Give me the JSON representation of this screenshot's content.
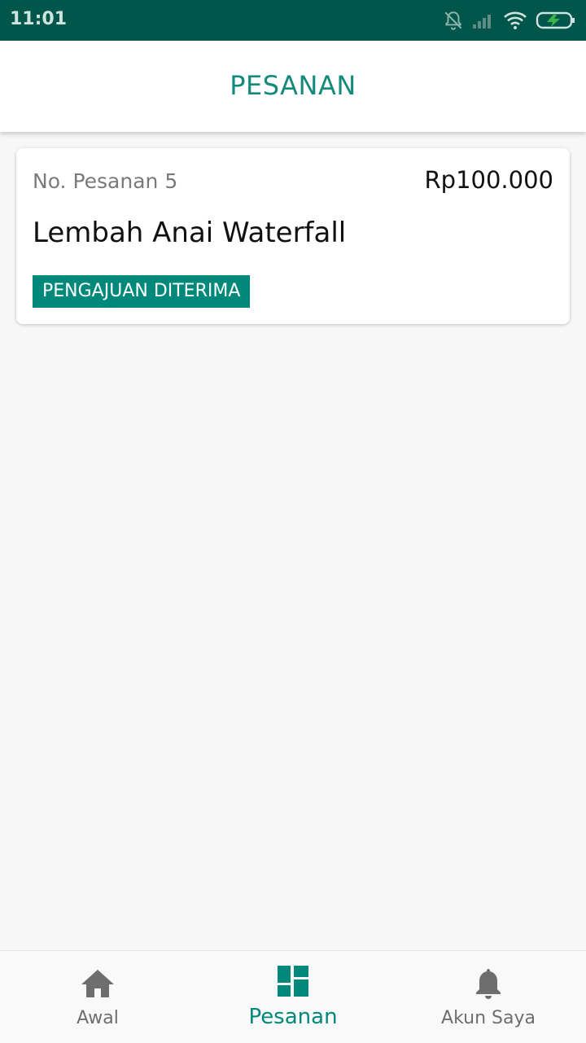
{
  "status_bar": {
    "time": "11:01",
    "icons": [
      "bell-off-icon",
      "signal-icon",
      "wifi-icon",
      "battery-charging-icon"
    ]
  },
  "header": {
    "title": "PESANAN"
  },
  "orders": [
    {
      "number_label": "No. Pesanan 5",
      "price": "Rp100.000",
      "title": "Lembah Anai Waterfall",
      "status": "PENGAJUAN DITERIMA"
    }
  ],
  "bottom_nav": {
    "items": [
      {
        "label": "Awal",
        "icon": "home-icon",
        "active": false
      },
      {
        "label": "Pesanan",
        "icon": "dashboard-icon",
        "active": true
      },
      {
        "label": "Akun Saya",
        "icon": "bell-icon",
        "active": false
      }
    ]
  },
  "colors": {
    "status_bar": "#00564a",
    "accent": "#00897b",
    "title": "#138a7a",
    "background": "#f7f7f7"
  }
}
